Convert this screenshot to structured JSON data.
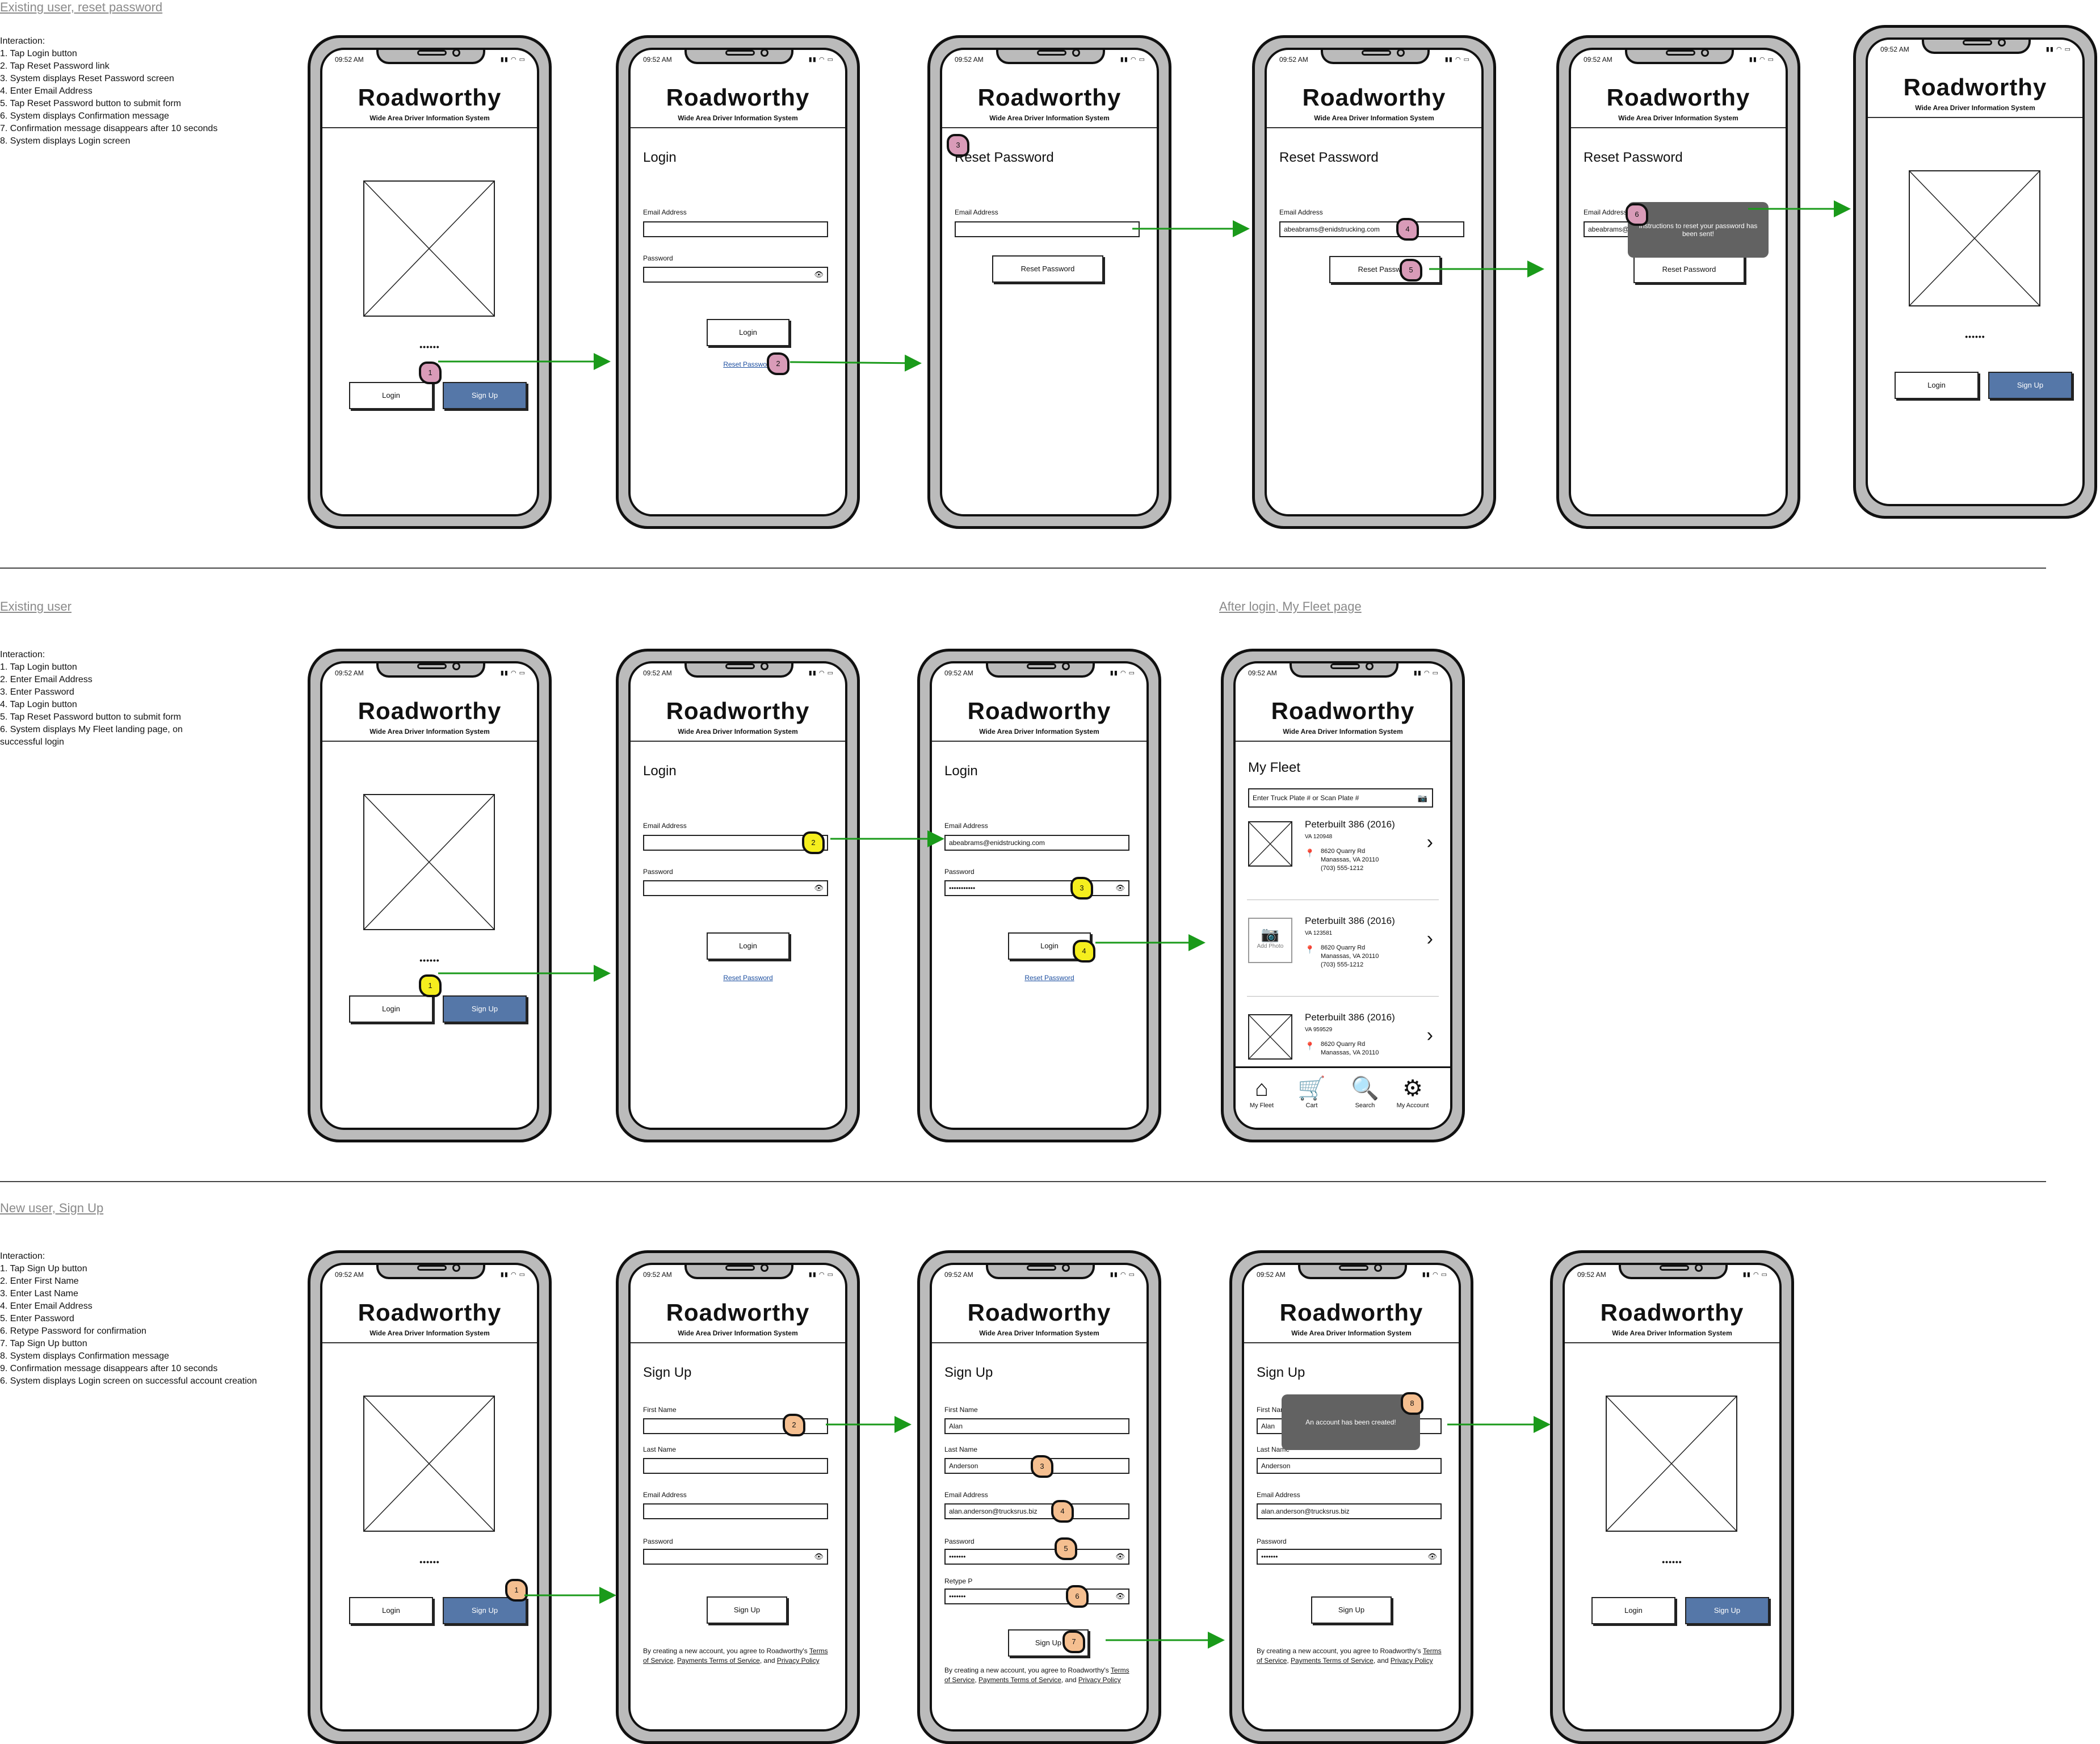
{
  "app": {
    "brand": "Roadworthy",
    "tagline": "Wide Area Driver Information System",
    "time": "09:52 AM",
    "status_icons": "▮▮ ◠ ▭"
  },
  "common": {
    "login_label": "Login",
    "signup_label": "Sign Up",
    "reset_password_link": "Reset Password",
    "reset_password_button": "Reset Password",
    "email_label": "Email Address",
    "password_label": "Password",
    "first_name_label": "First Name",
    "last_name_label": "Last Name",
    "retype_label": "Retype P",
    "password_dots": "••••••",
    "masked_password": "•••••••",
    "masked_password_long": "•••••••••••",
    "eye_icon": "👁",
    "legal": {
      "prefix": "By creating a new account, you agree to Roadworthy's ",
      "tos": "Terms of Service",
      "sep": ", ",
      "payments": "Payments Terms of Service",
      "and": ", and ",
      "privacy": "Privacy Policy"
    }
  },
  "titles": {
    "login": "Login",
    "reset": "Reset Password",
    "signup": "Sign Up",
    "fleet": "My Fleet"
  },
  "values": {
    "email": "abeabrams@enidstrucking.com",
    "first": "Alan",
    "last": "Anderson",
    "email2": "alan.anderson@trucksrus.biz"
  },
  "toasts": {
    "reset": "Instructions to reset your password has been sent!",
    "created": "An account has been created!"
  },
  "sections": [
    {
      "title": "Existing user, reset password",
      "intro": "Interaction:",
      "steps": [
        "1.  Tap Login button",
        "2. Tap Reset Password link",
        "3. System displays Reset Password screen",
        "4. Enter Email Address",
        "5. Tap Reset Password button to submit form",
        "6. System displays Confirmation message",
        "7. Confirmation message disappears after 10 seconds",
        "8. System displays Login screen"
      ]
    },
    {
      "title": "Existing user",
      "intro": "Interaction:",
      "steps": [
        "1.  Tap Login button",
        "2. Enter Email Address",
        "3. Enter Password",
        "4. Tap Login button",
        "5. Tap Reset Password button to submit form",
        "6. System displays My Fleet landing page, on successful login"
      ]
    },
    {
      "title": "New user, Sign Up",
      "intro": "Interaction:",
      "steps": [
        "1.  Tap Sign Up button",
        "2. Enter First Name",
        "3. Enter Last Name",
        "4. Enter Email Address",
        "5. Enter Password",
        "6. Retype Password for confirmation",
        "7. Tap Sign Up button",
        "8. System displays Confirmation message",
        "9. Confirmation message disappears after 10 seconds",
        "6. System displays Login screen on successful account creation"
      ]
    }
  ],
  "after_login_title": "After login, My Fleet page",
  "fleet": {
    "search_placeholder": "Enter Truck Plate # or Scan Plate #",
    "add_photo": "Add Photo",
    "trucks": [
      {
        "name": "Peterbuilt 386 (2016)",
        "plate": "VA 120948",
        "addr1": "8620 Quarry Rd",
        "addr2": "Manassas, VA 20110",
        "phone": "(703) 555-1212"
      },
      {
        "name": "Peterbuilt 386 (2016)",
        "plate": "VA 123581",
        "addr1": "8620 Quarry Rd",
        "addr2": "Manassas, VA 20110",
        "phone": "(703) 555-1212"
      },
      {
        "name": "Peterbuilt 386 (2016)",
        "plate": "VA 959529",
        "addr1": "8620 Quarry Rd",
        "addr2": "Manassas, VA 20110",
        "phone": ""
      }
    ],
    "tabs": [
      {
        "label": "My Fleet",
        "icon": "home-icon"
      },
      {
        "label": "Cart",
        "icon": "cart-icon"
      },
      {
        "label": "Search",
        "icon": "search-icon"
      },
      {
        "label": "My Account",
        "icon": "gear-icon"
      }
    ]
  },
  "markers": [
    "1",
    "2",
    "3",
    "4",
    "5",
    "6",
    "7",
    "8"
  ],
  "colors": {
    "primary_button": "#5577a8",
    "arrow": "#1a9a1a",
    "marker_reset": "#d99bb8",
    "marker_login": "#f5ee1e",
    "marker_signup": "#f5bf90",
    "toast": "#626262",
    "phone_frame": "#bbbbbb"
  }
}
